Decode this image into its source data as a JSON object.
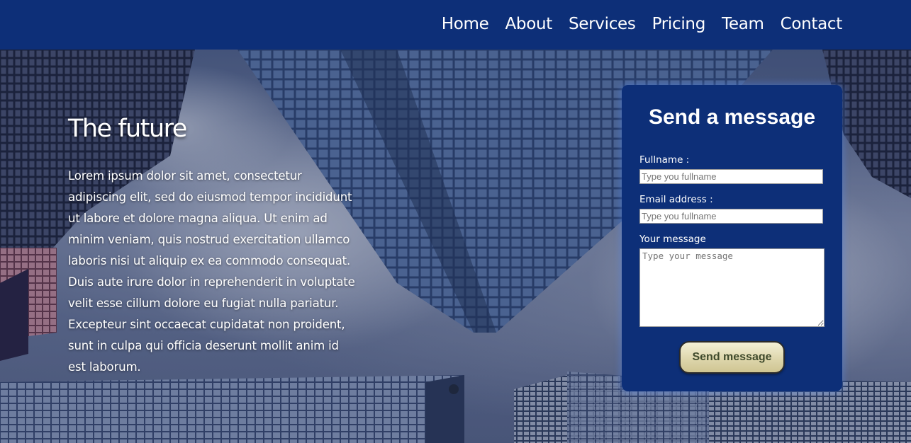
{
  "nav": {
    "items": [
      {
        "label": "Home"
      },
      {
        "label": "About"
      },
      {
        "label": "Services"
      },
      {
        "label": "Pricing"
      },
      {
        "label": "Team"
      },
      {
        "label": "Contact"
      }
    ]
  },
  "hero": {
    "title": "The future",
    "text": "Lorem ipsum dolor sit amet, consectetur adipiscing elit, sed do eiusmod tempor incididunt ut labore et dolore magna aliqua. Ut enim ad minim veniam, quis nostrud exercitation ullamco laboris nisi ut aliquip ex ea commodo consequat. Duis aute irure dolor in reprehenderit in voluptate velit esse cillum dolore eu fugiat nulla pariatur. Excepteur sint occaecat cupidatat non proident, sunt in culpa qui officia deserunt mollit anim id est laborum."
  },
  "form": {
    "title": "Send a message",
    "fullname_label": "Fullname :",
    "fullname_placeholder": "Type you fullname",
    "fullname_value": "",
    "email_label": "Email address :",
    "email_placeholder": "Type you fullname",
    "email_value": "",
    "message_label": "Your message",
    "message_placeholder": "Type your message",
    "message_value": "",
    "submit_label": "Send message"
  },
  "colors": {
    "nav_background": "#0d2f78",
    "form_background": "#0d2f78",
    "text": "#ffffff",
    "button_background": "#e5dfba",
    "button_text": "#3f4a2c"
  }
}
